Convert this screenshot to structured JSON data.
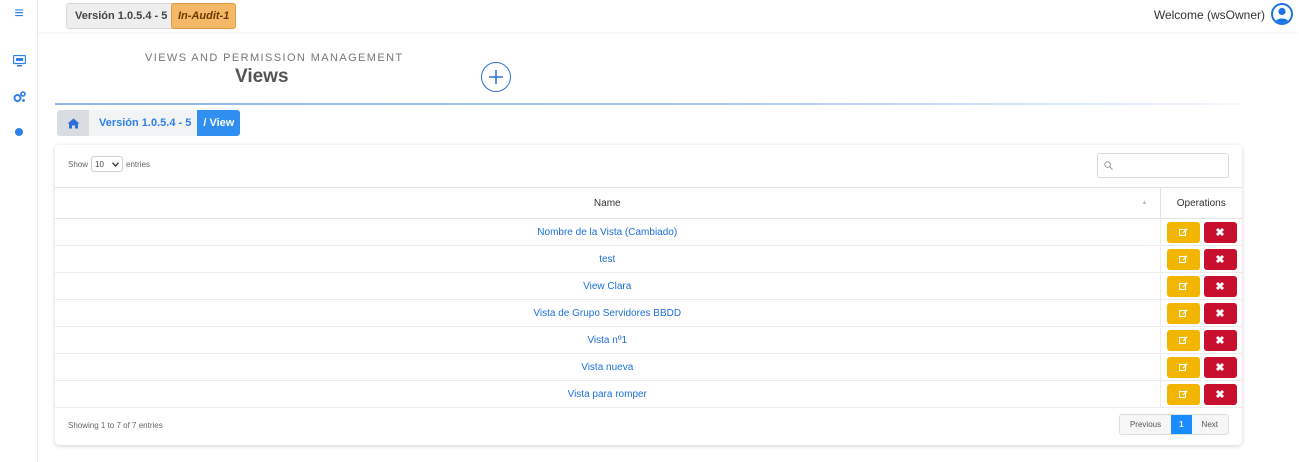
{
  "sidebar": {
    "items": [
      {
        "icon": "menu-icon"
      },
      {
        "icon": "monitor-icon"
      },
      {
        "icon": "gears-icon"
      },
      {
        "icon": "circle-icon"
      }
    ]
  },
  "topbar": {
    "version": "Versión 1.0.5.4 - 5",
    "audit": "In-Audit-1",
    "welcome": "Welcome (wsOwner)"
  },
  "header": {
    "subtitle": "VIEWS AND PERMISSION MANAGEMENT",
    "title": "Views"
  },
  "breadcrumb": {
    "version": "Versión 1.0.5.4 - 5",
    "current": "/ View"
  },
  "table": {
    "show_label": "Show",
    "entries_value": "10",
    "entries_label": "entries",
    "columns": {
      "name": "Name",
      "operations": "Operations"
    },
    "rows": [
      "Nombre de la Vista (Cambiado)",
      "test",
      "View Clara",
      "Vista de Grupo Servidores BBDD",
      "Vista nº1",
      "Vista nueva",
      "Vista para romper"
    ],
    "info": "Showing 1 to 7 of 7 entries",
    "pagination": {
      "previous": "Previous",
      "page": "1",
      "next": "Next"
    }
  },
  "colors": {
    "accent": "#2f80ed",
    "edit": "#f2b600",
    "delete": "#c8102e",
    "audit": "#f5b869"
  }
}
